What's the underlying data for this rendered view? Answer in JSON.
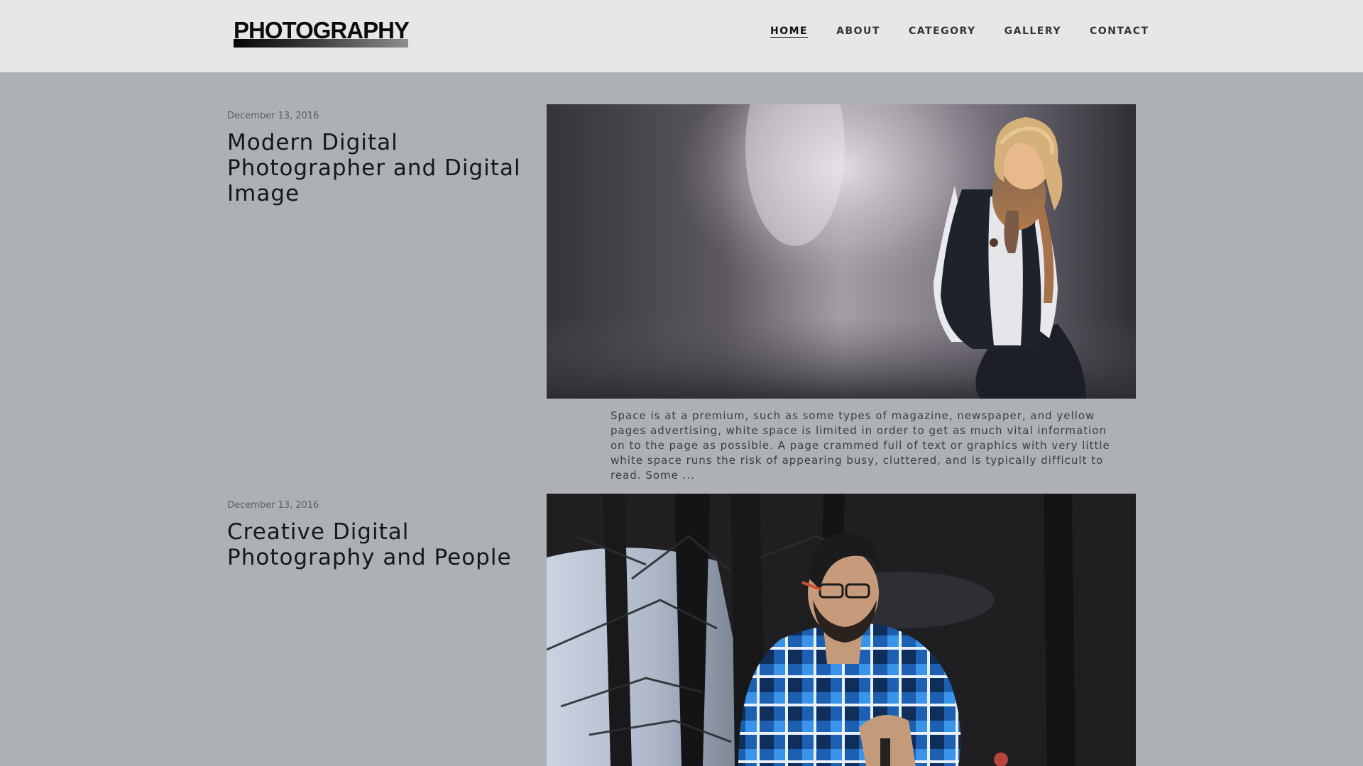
{
  "header": {
    "logo_text": "PHOTOGRAPHY",
    "nav": [
      {
        "label": "HOME",
        "active": true
      },
      {
        "label": "ABOUT",
        "active": false
      },
      {
        "label": "CATEGORY",
        "active": false
      },
      {
        "label": "GALLERY",
        "active": false
      },
      {
        "label": "CONTACT",
        "active": false
      }
    ]
  },
  "posts": [
    {
      "date": "December 13, 2016",
      "title": "Modern Digital Photographer and Digital Image",
      "image": "photo-woman-with-scarf",
      "excerpt": "Space is at a premium, such as some types of magazine, newspaper, and yellow pages advertising, white space is limited in order to get as much vital information on to the page as possible. A page crammed full of text or graphics with very little white space runs the risk of appearing busy, cluttered, and is typically difficult to read. Some ..."
    },
    {
      "date": "December 13, 2016",
      "title": "Creative Digital Photography and People",
      "image": "photo-man-in-forest"
    }
  ],
  "colors": {
    "header_bg": "#e6e7e9",
    "page_bg": "#adb0b5",
    "text_dark": "#15171a",
    "plaid_blue": "#2a7fd6"
  }
}
